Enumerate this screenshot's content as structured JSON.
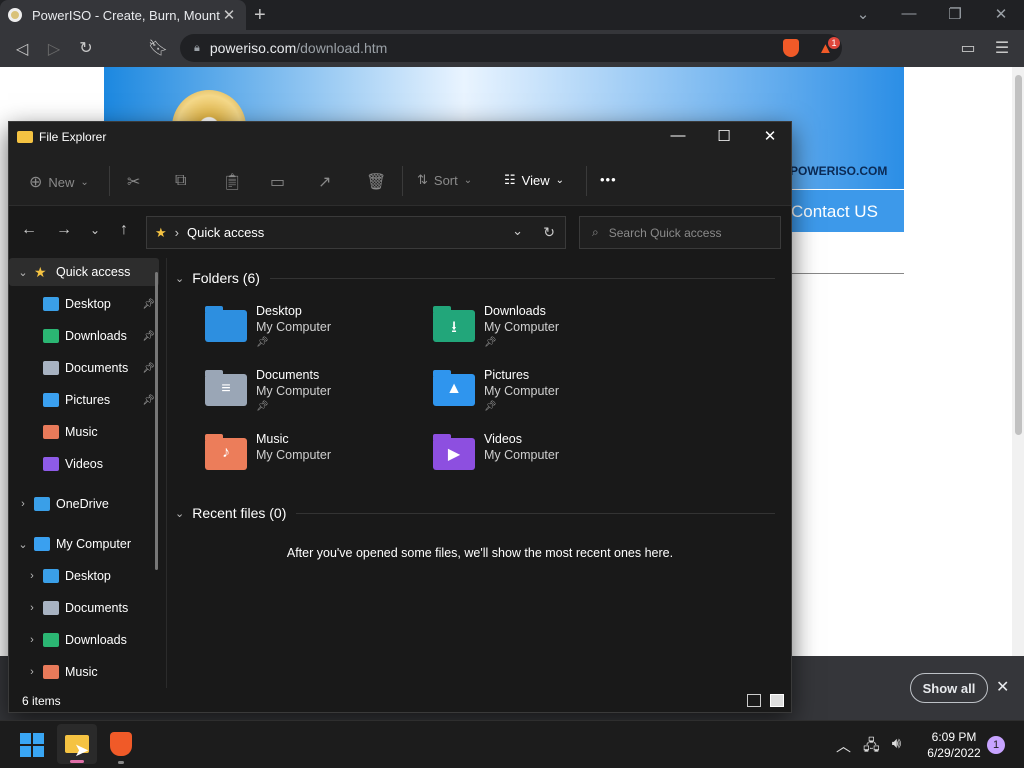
{
  "browser": {
    "tab_title": "PowerISO - Create, Burn, Mount, E",
    "tab_close": "✕",
    "new_tab": "+",
    "url_host": "poweriso.com",
    "url_path": "/download.htm",
    "brave_badge": "1"
  },
  "webpage": {
    "domain_text": "POWERISO.COM",
    "contact_label": "Contact US"
  },
  "download_shelf": {
    "show_all_label": "Show all"
  },
  "explorer": {
    "window_title": "File Explorer",
    "toolbar": {
      "new_label": "New",
      "sort_label": "Sort",
      "view_label": "View",
      "more_label": "•••"
    },
    "address": {
      "location": "Quick access",
      "search_placeholder": "Search Quick access"
    },
    "sidebar": [
      {
        "label": "Quick access",
        "icon": "star-icon",
        "color": "#f5c342",
        "level": 0,
        "expanded": true,
        "pinned": false
      },
      {
        "label": "Desktop",
        "icon": "desktop-icon",
        "color": "#3a9fe8",
        "level": 1,
        "pinned": true
      },
      {
        "label": "Downloads",
        "icon": "download-icon",
        "color": "#2bb673",
        "level": 1,
        "pinned": true
      },
      {
        "label": "Documents",
        "icon": "document-icon",
        "color": "#a8b3c2",
        "level": 1,
        "pinned": true
      },
      {
        "label": "Pictures",
        "icon": "picture-icon",
        "color": "#3aa0f0",
        "level": 1,
        "pinned": true
      },
      {
        "label": "Music",
        "icon": "music-icon",
        "color": "#e87a5a",
        "level": 1,
        "pinned": false
      },
      {
        "label": "Videos",
        "icon": "video-icon",
        "color": "#8e5be8",
        "level": 1,
        "pinned": false
      },
      {
        "label": "OneDrive",
        "icon": "cloud-icon",
        "color": "#3a9fe8",
        "level": 0,
        "expanded": false,
        "pinned": false
      },
      {
        "label": "My Computer",
        "icon": "computer-icon",
        "color": "#3aa0f0",
        "level": 0,
        "expanded": true,
        "pinned": false
      },
      {
        "label": "Desktop",
        "icon": "desktop-icon",
        "color": "#3a9fe8",
        "level": 1,
        "expandable": true,
        "pinned": false
      },
      {
        "label": "Documents",
        "icon": "document-icon",
        "color": "#a8b3c2",
        "level": 1,
        "expandable": true,
        "pinned": false
      },
      {
        "label": "Downloads",
        "icon": "download-icon",
        "color": "#2bb673",
        "level": 1,
        "expandable": true,
        "pinned": false
      },
      {
        "label": "Music",
        "icon": "music-icon",
        "color": "#e87a5a",
        "level": 1,
        "expandable": true,
        "pinned": false
      }
    ],
    "folders_heading": "Folders (6)",
    "folders": [
      {
        "name": "Desktop",
        "location": "My Computer",
        "pinned": true,
        "icon": "desktop-folder-icon",
        "color": "#2d8fe0",
        "glyph": ""
      },
      {
        "name": "Downloads",
        "location": "My Computer",
        "pinned": true,
        "icon": "downloads-folder-icon",
        "color": "#22a67a",
        "glyph": "⭳"
      },
      {
        "name": "Documents",
        "location": "My Computer",
        "pinned": true,
        "icon": "documents-folder-icon",
        "color": "#9aa6b6",
        "glyph": "≡"
      },
      {
        "name": "Pictures",
        "location": "My Computer",
        "pinned": true,
        "icon": "pictures-folder-icon",
        "color": "#2f95ee",
        "glyph": "▲"
      },
      {
        "name": "Music",
        "location": "My Computer",
        "pinned": false,
        "icon": "music-folder-icon",
        "color": "#ec7d5a",
        "glyph": "♪"
      },
      {
        "name": "Videos",
        "location": "My Computer",
        "pinned": false,
        "icon": "videos-folder-icon",
        "color": "#8d4fe0",
        "glyph": "▶"
      }
    ],
    "recent_heading": "Recent files (0)",
    "recent_message": "After you've opened some files, we'll show the most recent ones here.",
    "status_text": "6 items"
  },
  "taskbar": {
    "time": "6:09 PM",
    "date": "6/29/2022",
    "notification_count": "1"
  }
}
